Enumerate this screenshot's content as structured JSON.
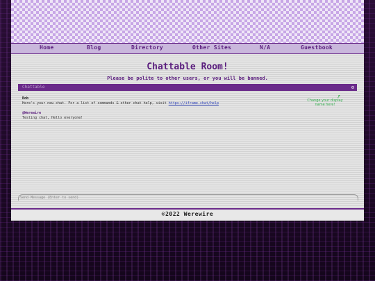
{
  "nav": {
    "items": [
      "Home",
      "Blog",
      "Directory",
      "Other Sites",
      "N/A",
      "Guestbook"
    ]
  },
  "page": {
    "title": "Chattable Room!",
    "subtitle": "Please be polite to other users, or you will be banned."
  },
  "chat": {
    "header_label": "Chattable",
    "settings_icon": "gear-icon",
    "hint": "Change your display name here!",
    "messages": [
      {
        "user": "Bob",
        "text": "Here's your new chat. For a list of commands & other chat help, visit ",
        "link": "https://iframe.chat/help"
      },
      {
        "user": "@Werewire",
        "text": "Testing chat, Hello everyone!"
      }
    ],
    "input_placeholder": "Send Message (Enter to send)"
  },
  "footer": {
    "text": "©2022 Werewire"
  },
  "colors": {
    "accent": "#5a1d7e",
    "hint": "#2fae4a"
  }
}
